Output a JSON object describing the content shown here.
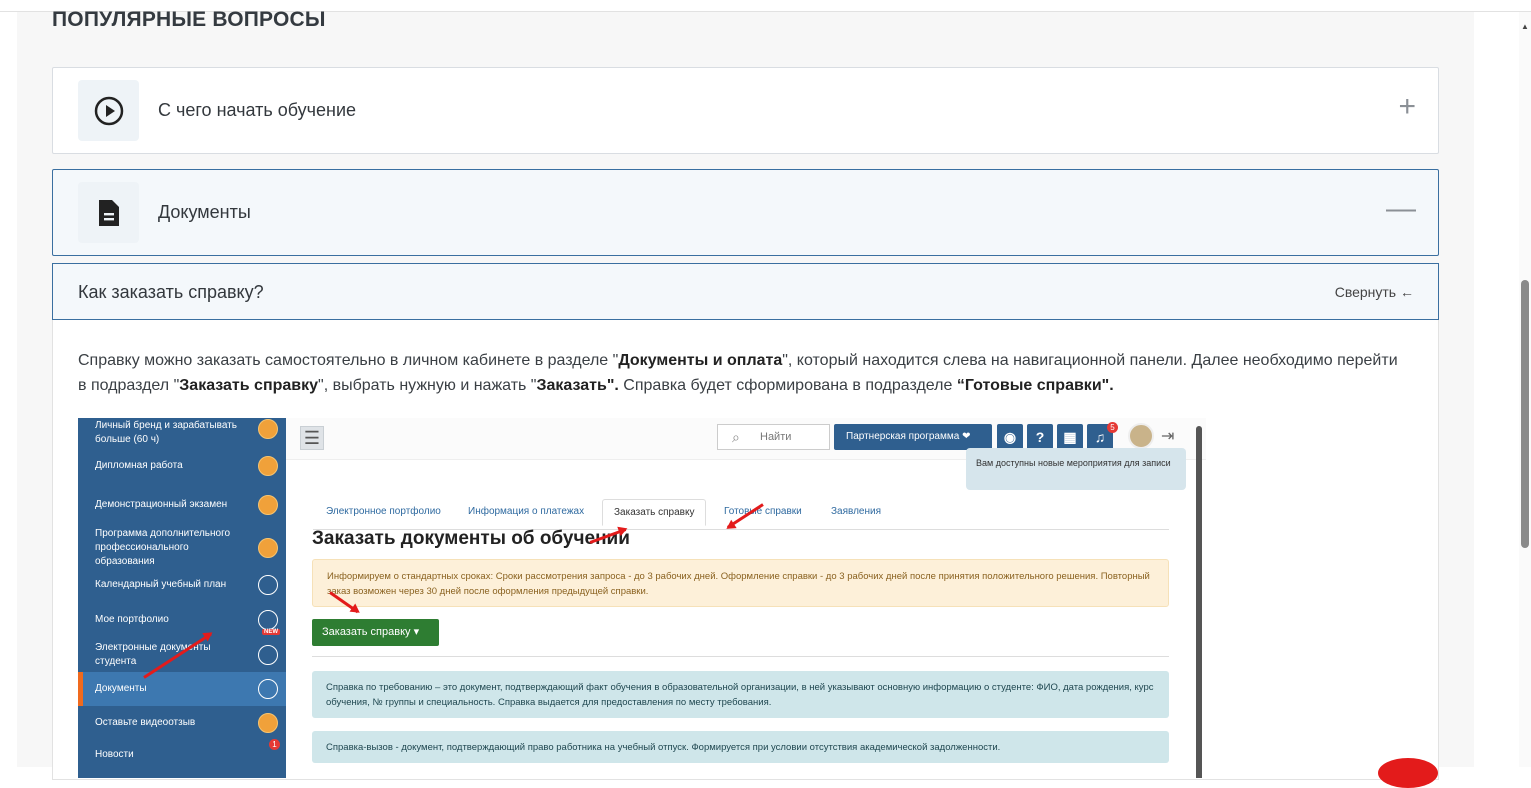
{
  "faq": {
    "section_title": "ПОПУЛЯРНЫЕ ВОПРОСЫ",
    "items": [
      {
        "label": "С чего начать обучение",
        "icon": "play-circle-icon",
        "toggle": "+"
      },
      {
        "label": "Документы",
        "icon": "document-icon",
        "toggle": "—"
      }
    ],
    "question": {
      "title": "Как заказать справку?",
      "collapse_label": "Свернуть ←"
    },
    "answer": {
      "p1": "Справку можно заказать самостоятельно в личном кабинете в разделе \"",
      "b1": "Документы и оплата",
      "p2": "\", который находится слева на навигационной панели. Далее необходимо перейти в подраздел \"",
      "b2": "Заказать справку",
      "p3": "\", выбрать нужную и нажать \"",
      "b3": "Заказать\".",
      "p4": " Справка будет сформирована в подразделе ",
      "b4": "“Готовые справки\"."
    }
  },
  "screenshot": {
    "sidebar": [
      {
        "label": "Личный бренд и зарабатывать больше (60 ч)",
        "icon": "book-icon"
      },
      {
        "label": "Дипломная работа",
        "icon": "book-icon"
      },
      {
        "label": "Демонстрационный экзамен",
        "icon": "book-icon"
      },
      {
        "label": "Программа дополнительного профессионального образования",
        "icon": "book-icon"
      },
      {
        "label": "Календарный учебный план",
        "icon": "calendar-icon"
      },
      {
        "label": "Мое портфолио",
        "icon": "portfolio-icon",
        "badge": "NEW"
      },
      {
        "label": "Электронные документы студента",
        "icon": "docs-icon"
      },
      {
        "label": "Документы",
        "icon": "docs-icon",
        "active": true
      },
      {
        "label": "Оставьте видеоотзыв",
        "icon": "video-icon"
      },
      {
        "label": "Новости",
        "icon": "megaphone-icon",
        "badge": "1"
      }
    ],
    "topbar": {
      "search_placeholder": "Найти",
      "partner_label": "Партнерская программа",
      "help_label": "?",
      "notif_count": "5",
      "tooltip": "Вам доступны новые мероприятия для записи"
    },
    "tabs": [
      "Электронное портфолио",
      "Информация о платежах",
      "Заказать справку",
      "Готовые справки",
      "Заявления"
    ],
    "active_tab": "Заказать справку",
    "heading": "Заказать документы об обучении",
    "alert": "Информируем о стандартных сроках: Сроки рассмотрения запроса - до 3 рабочих дней. Оформление справки - до 3 рабочих дней после принятия положительного решения. Повторный заказ возможен через 30 дней после оформления предыдущей справки.",
    "order_button": "Заказать справку ▾",
    "info1": "Справка по требованию – это документ, подтверждающий факт обучения в образовательной организации, в ней указывают основную информацию о студенте: ФИО, дата рождения, курс обучения, № группы и специальность. Справка выдается для предоставления по месту требования.",
    "info2": "Справка-вызов - документ, подтверждающий право работника на учебный отпуск. Формируется при условии отсутствия академической задолженности."
  },
  "colors": {
    "accent": "#2f5f8f",
    "arrow": "#e31b1b",
    "green": "#2e7d32"
  }
}
